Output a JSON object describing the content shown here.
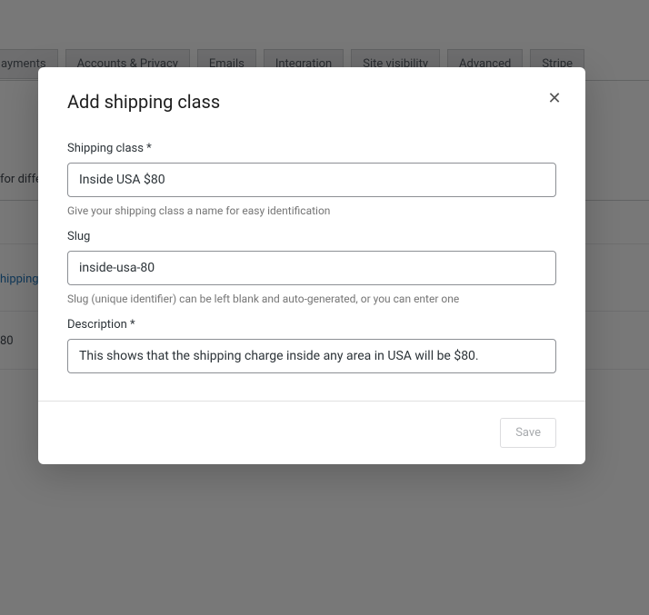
{
  "background": {
    "tabs": [
      "ayments",
      "Accounts & Privacy",
      "Emails",
      "Integration",
      "Site visibility",
      "Advanced",
      "Stripe"
    ],
    "text1": "for diffe",
    "text2": "hipping",
    "text3": "80"
  },
  "modal": {
    "title": "Add shipping class",
    "close_symbol": "✕",
    "fields": {
      "name": {
        "label": "Shipping class *",
        "value": "Inside USA $80",
        "helper": "Give your shipping class a name for easy identification"
      },
      "slug": {
        "label": "Slug",
        "value": "inside-usa-80",
        "helper": "Slug (unique identifier) can be left blank and auto-generated, or you can enter one"
      },
      "description": {
        "label": "Description *",
        "value": "This shows that the shipping charge inside any area in USA will be $80."
      }
    },
    "save_label": "Save"
  }
}
